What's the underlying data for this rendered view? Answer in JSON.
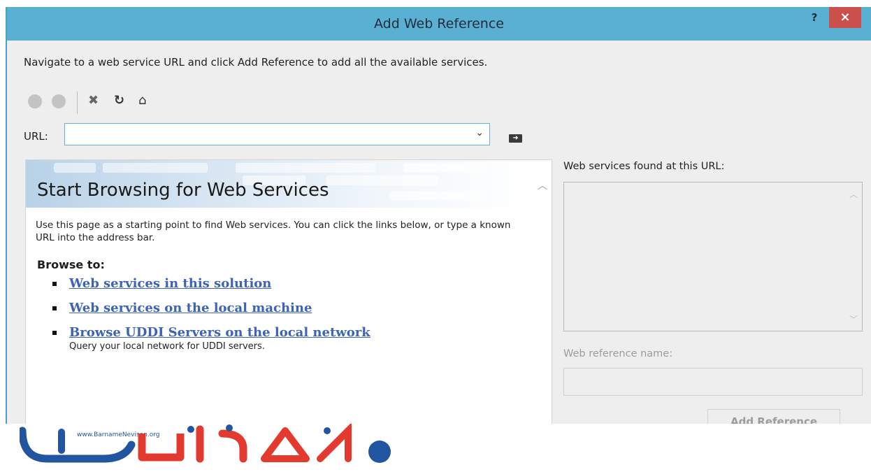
{
  "window": {
    "title": "Add Web Reference",
    "help_label": "?",
    "close_label": "×"
  },
  "instruction": "Navigate to a web service URL and click Add Reference to add all the available services.",
  "toolbar": {
    "back_icon": "back-circle-icon",
    "forward_icon": "forward-circle-icon",
    "stop_icon": "stop-x-icon",
    "refresh_icon": "refresh-icon",
    "home_icon": "home-icon"
  },
  "url": {
    "label": "URL:",
    "value": "",
    "go_icon": "go-arrow-icon"
  },
  "browser": {
    "title": "Start Browsing for Web Services",
    "intro": "Use this page as a starting point to find Web services. You can click the links below, or type a known URL into the address bar.",
    "browse_heading": "Browse to:",
    "links": [
      {
        "label": "Web services in this solution",
        "description": ""
      },
      {
        "label": "Web services on the local machine",
        "description": ""
      },
      {
        "label": "Browse UDDI Servers on the local network",
        "description": "Query your local network for UDDI servers."
      }
    ]
  },
  "right_pane": {
    "found_label": "Web services found at this URL:",
    "ref_name_label": "Web reference name:",
    "ref_name_value": "",
    "add_button": "Add Reference"
  },
  "watermark": {
    "url_text": "www.BarnameNevisan.org",
    "colors": {
      "blue": "#2255a0",
      "red": "#e23a2e"
    }
  }
}
